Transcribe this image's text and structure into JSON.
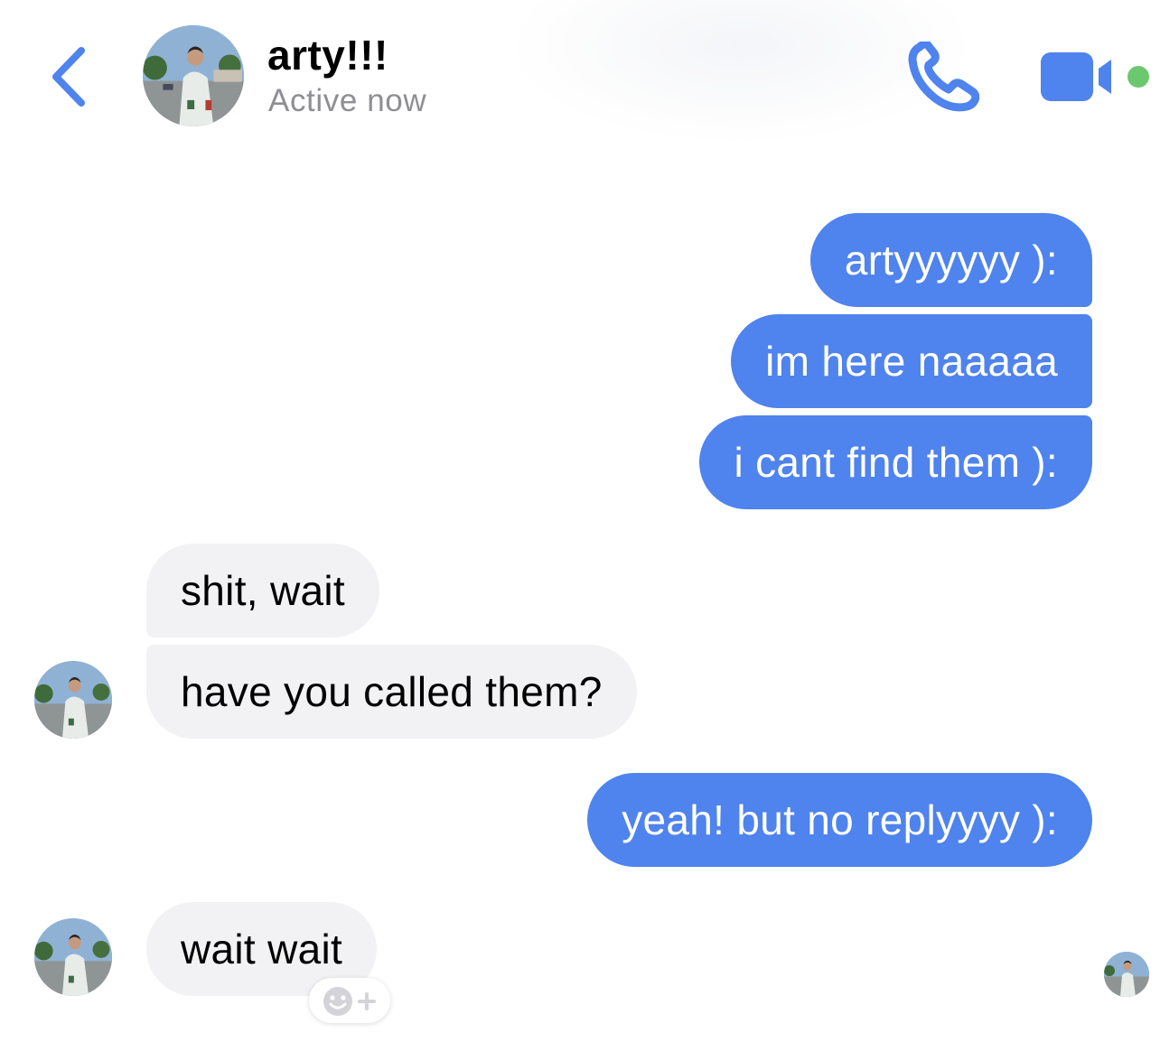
{
  "header": {
    "contact_name": "arty!!!",
    "status": "Active now"
  },
  "colors": {
    "accent": "#4f83ed",
    "incoming_bubble": "#f2f2f4",
    "online_dot": "#6cc86f",
    "status_text": "#8e8e93"
  },
  "icons": {
    "back": "chevron-left-icon",
    "call": "phone-icon",
    "video": "video-camera-icon",
    "react": "smiley-plus-icon"
  },
  "messages": [
    {
      "from": "me",
      "text": "artyyyyyy ):"
    },
    {
      "from": "me",
      "text": "im here naaaaa"
    },
    {
      "from": "me",
      "text": "i cant find them ):"
    },
    {
      "from": "contact",
      "text": "shit, wait"
    },
    {
      "from": "contact",
      "text": "have you called them?"
    },
    {
      "from": "me",
      "text": "yeah! but no replyyyy ):"
    },
    {
      "from": "contact",
      "text": "wait wait"
    }
  ]
}
